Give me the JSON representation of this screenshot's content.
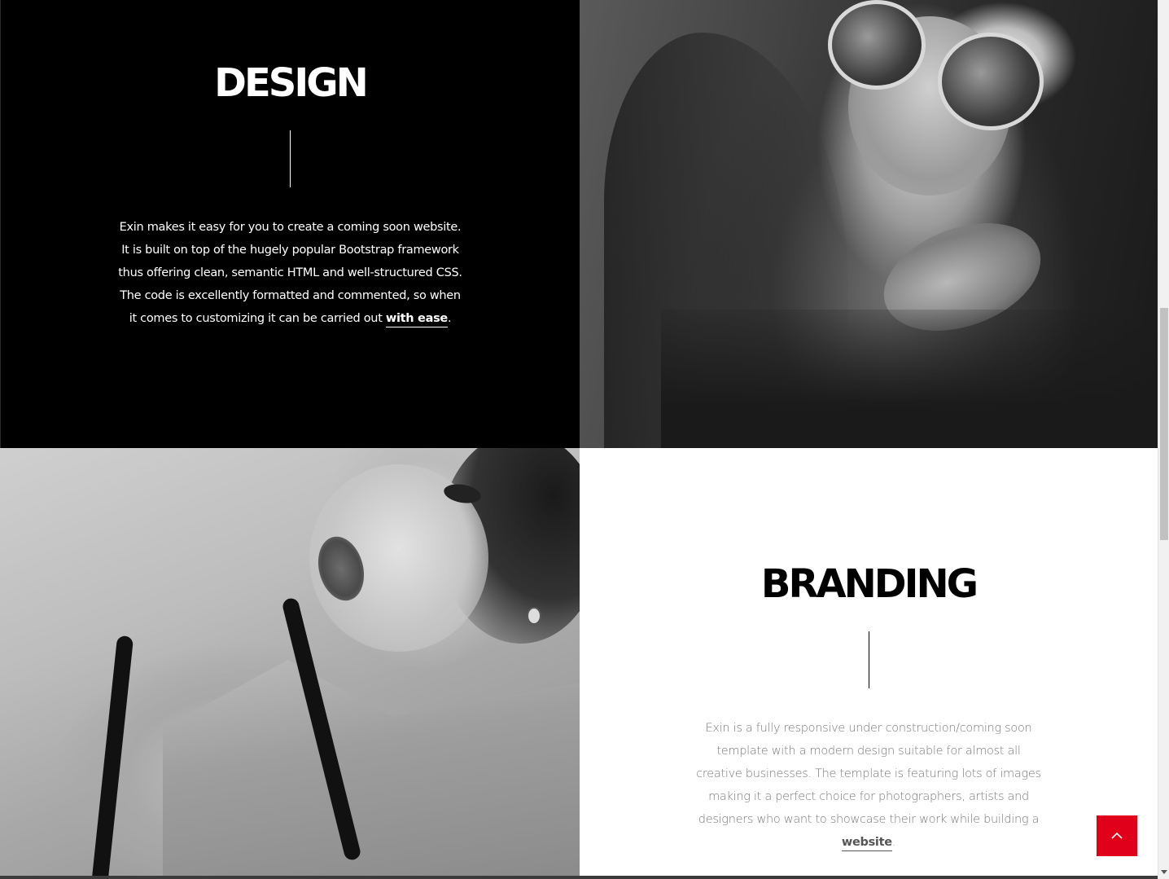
{
  "design_section": {
    "title": "DESIGN",
    "body_text": "Exin makes it easy for you to create a coming soon website. It is built on top of the hugely popular Bootstrap framework thus offering clean, semantic HTML and well-structured CSS. The code is excellently formatted and commented, so when it comes to customizing it can be carried out ",
    "link_text": "with ease",
    "trailing": "."
  },
  "branding_section": {
    "title": "BRANDING",
    "body_text": "Exin is a fully responsive under construction/coming soon template with a modern design suitable for almost all creative businesses. The template is featuring lots of images making it a perfect choice for photographers, artists and designers who want to showcase their work while building a ",
    "link_text": "website",
    "trailing": "."
  },
  "photos": {
    "top_right": "portrait-woman-round-sunglasses",
    "bottom_left": "portrait-woman-holding-glasses"
  },
  "back_to_top": {
    "icon": "chevron-up-icon"
  },
  "colors": {
    "accent": "#e1001a",
    "dark_panel": "#000000",
    "light_panel": "#ffffff",
    "branding_text": "#7a7a7a"
  }
}
